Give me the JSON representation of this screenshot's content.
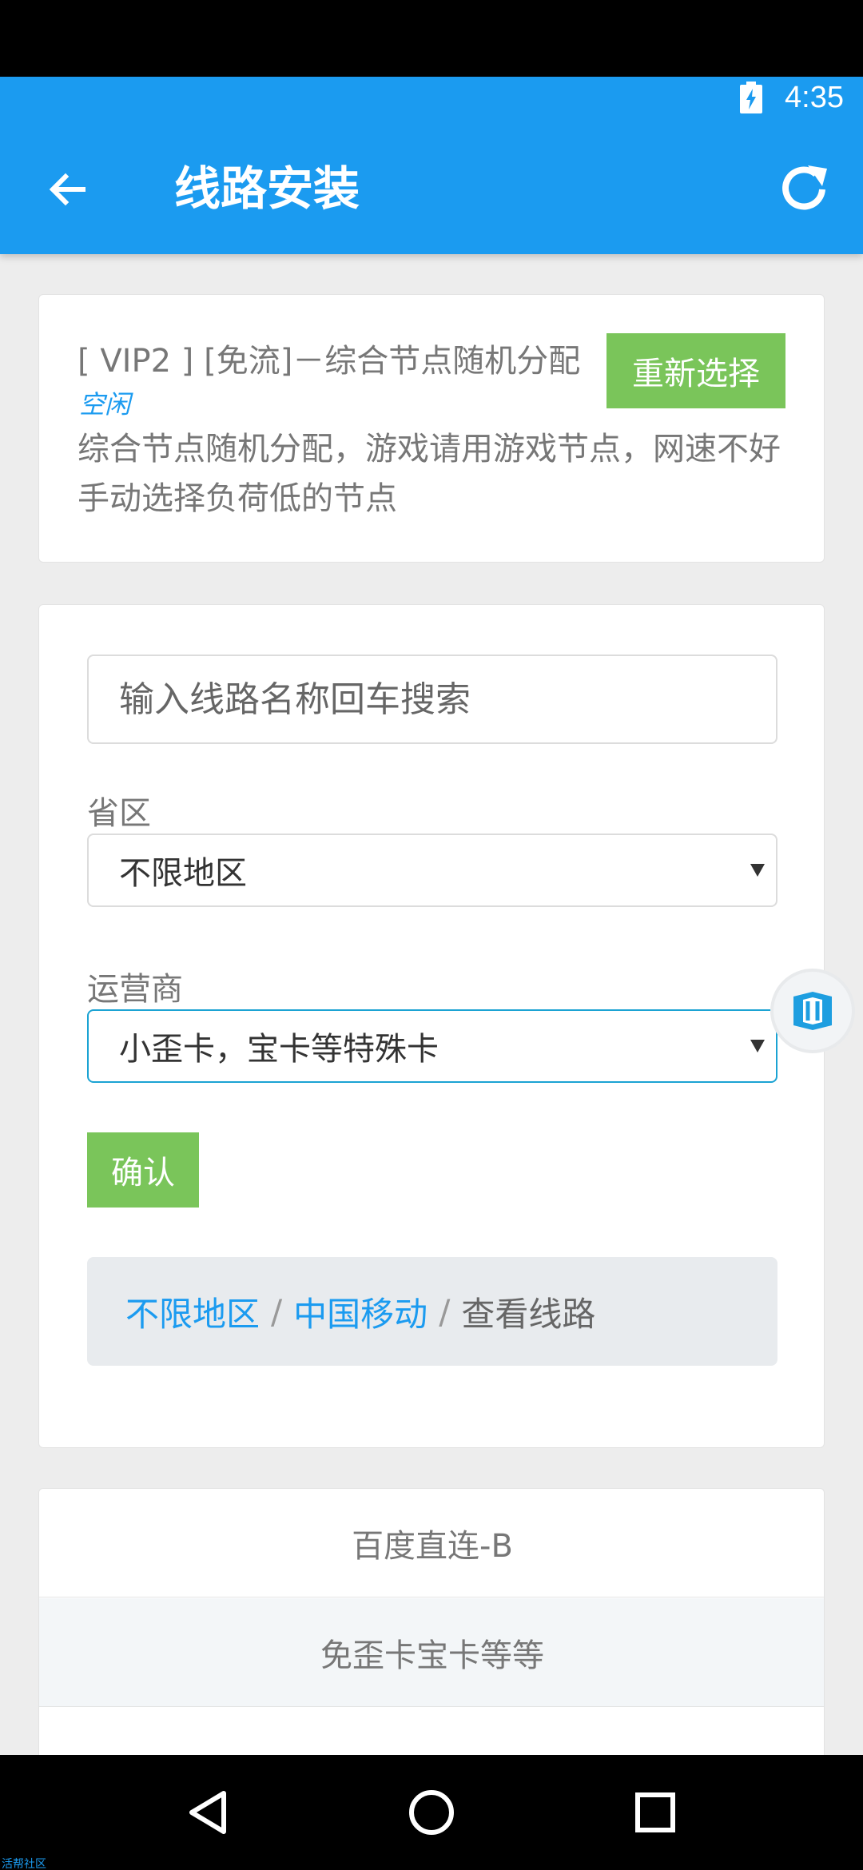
{
  "status_bar": {
    "time": "4:35"
  },
  "header": {
    "title": "线路安装"
  },
  "selected_line": {
    "title": "[ VIP2 ] [免流]－综合节点随机分配",
    "status": "空闲",
    "description": "综合节点随机分配，游戏请用游戏节点，网速不好手动选择负荷低的节点",
    "reselect_label": "重新选择"
  },
  "search": {
    "placeholder": "输入线路名称回车搜索",
    "value": ""
  },
  "province": {
    "label": "省区",
    "selected": "不限地区"
  },
  "carrier": {
    "label": "运营商",
    "selected": "小歪卡，宝卡等特殊卡"
  },
  "confirm_label": "确认",
  "breadcrumb": {
    "items": [
      "不限地区",
      "中国移动"
    ],
    "separator": "/",
    "current": "查看线路"
  },
  "line_list": [
    "百度直连-B",
    "免歪卡宝卡等等",
    ""
  ],
  "watermark": "活帮社区",
  "colors": {
    "primary": "#1b9bf0",
    "button_green": "#7ac55a",
    "background": "#ededed"
  },
  "icons": {
    "back": "arrow-left-icon",
    "refresh": "refresh-icon",
    "battery": "battery-charging-icon",
    "float": "cube-icon",
    "nav_back": "triangle-back-icon",
    "nav_home": "circle-home-icon",
    "nav_recents": "square-recents-icon"
  }
}
